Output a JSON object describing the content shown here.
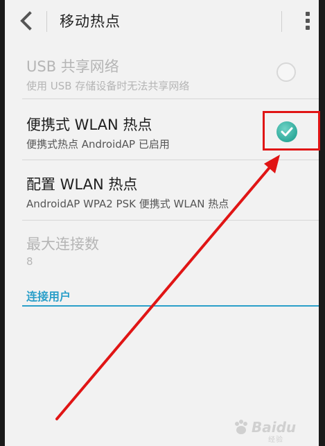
{
  "header": {
    "title": "移动热点",
    "back_icon": "chevron-left-icon",
    "menu_icon": "overflow-menu-icon"
  },
  "settings": [
    {
      "title": "USB 共享网络",
      "summary": "使用 USB 存储设备时无法共享网络",
      "enabled": false,
      "checked": false
    },
    {
      "title": "便携式 WLAN 热点",
      "summary": "便携式热点 AndroidAP 已启用",
      "enabled": true,
      "checked": true
    },
    {
      "title": "配置 WLAN 热点",
      "summary": "AndroidAP WPA2 PSK 便携式 WLAN 热点",
      "enabled": true
    },
    {
      "title": "最大连接数",
      "summary": "8",
      "enabled": false
    }
  ],
  "section": {
    "label": "连接用户"
  },
  "colors": {
    "accent": "#2a9fc9",
    "check": "#2ea99a",
    "annotation": "#e01515"
  },
  "watermark": {
    "text": "Baidu",
    "sub": "经验"
  }
}
